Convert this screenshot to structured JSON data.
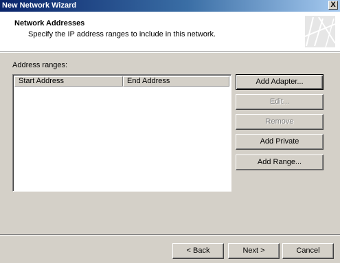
{
  "window": {
    "title": "New Network Wizard",
    "close_glyph": "X"
  },
  "header": {
    "title": "Network Addresses",
    "subtitle": "Specify the IP address ranges to include in this network."
  },
  "address_ranges": {
    "label": "Address ranges:",
    "columns": [
      "Start Address",
      "End Address"
    ],
    "rows": []
  },
  "side_buttons": {
    "add_adapter": "Add Adapter...",
    "edit": "Edit...",
    "remove": "Remove",
    "add_private": "Add Private",
    "add_range": "Add Range..."
  },
  "footer": {
    "back": "< Back",
    "next": "Next >",
    "cancel": "Cancel"
  }
}
